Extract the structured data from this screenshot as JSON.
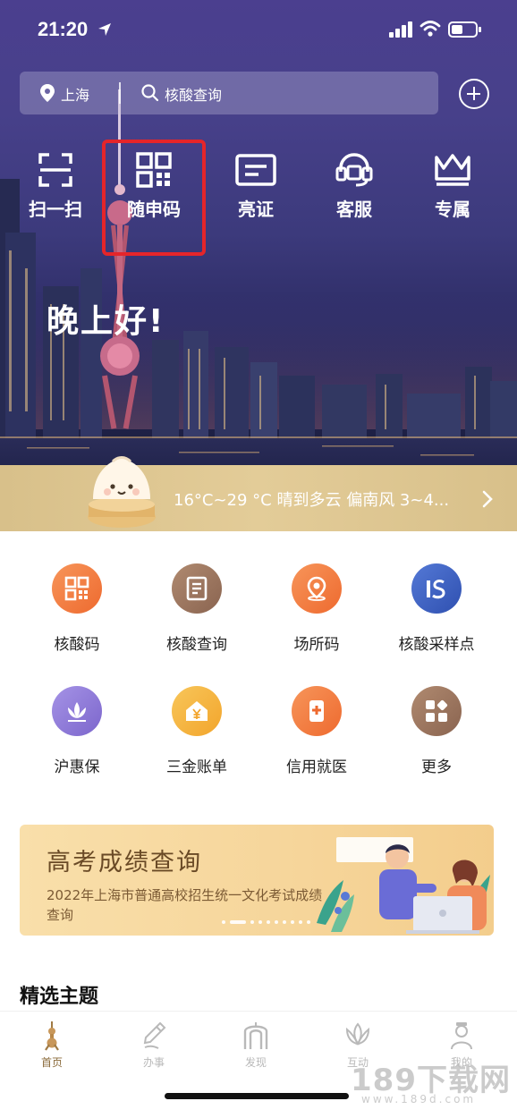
{
  "status": {
    "time": "21:20"
  },
  "search": {
    "city": "上海",
    "placeholder": "核酸查询"
  },
  "quick_actions": [
    {
      "label": "扫一扫",
      "icon": "scan-icon"
    },
    {
      "label": "随申码",
      "icon": "qr-code-icon"
    },
    {
      "label": "亮证",
      "icon": "id-card-icon"
    },
    {
      "label": "客服",
      "icon": "headset-icon"
    },
    {
      "label": "专属",
      "icon": "crown-icon"
    }
  ],
  "greeting": "晚上好!",
  "weather": {
    "text": "16°C~29 °C 晴到多云 偏南风 3~4..."
  },
  "services": [
    {
      "label": "核酸码",
      "icon": "qr-code-icon",
      "color": "#f07a3c"
    },
    {
      "label": "核酸查询",
      "icon": "document-icon",
      "color": "#9a7258"
    },
    {
      "label": "场所码",
      "icon": "location-pin-icon",
      "color": "#f07a3c"
    },
    {
      "label": "核酸采样点",
      "icon": "sampling-site-icon",
      "color": "#3f63c5"
    },
    {
      "label": "沪惠保",
      "icon": "lotus-icon",
      "color": "#8d78d8"
    },
    {
      "label": "三金账单",
      "icon": "house-yen-icon",
      "color": "#f5b63a"
    },
    {
      "label": "信用就医",
      "icon": "medical-phone-icon",
      "color": "#f07a3c"
    },
    {
      "label": "更多",
      "icon": "grid-more-icon",
      "color": "#9a7258"
    }
  ],
  "banner": {
    "title": "高考成绩查询",
    "subtitle": "2022年上海市普通高校招生统一文化考试成绩查询"
  },
  "section_title": "精选主题",
  "tabs": [
    {
      "label": "首页",
      "icon": "home-tower-icon",
      "active": true
    },
    {
      "label": "办事",
      "icon": "pen-icon",
      "active": false
    },
    {
      "label": "发现",
      "icon": "arch-icon",
      "active": false
    },
    {
      "label": "互动",
      "icon": "magnolia-icon",
      "active": false
    },
    {
      "label": "我的",
      "icon": "person-icon",
      "active": false
    }
  ],
  "watermark": {
    "main": "189下载网",
    "sub": "www.189d.com"
  },
  "colors": {
    "accent": "#f07a3c",
    "highlight": "#e5252a",
    "hero": "#4b3f8f",
    "weather": "#dcc48f"
  }
}
